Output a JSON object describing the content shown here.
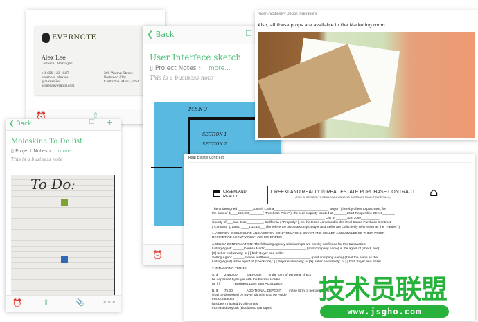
{
  "business_card": {
    "brand": "EVERNOTE",
    "name": "Alex Lee",
    "role": "General Manager",
    "contacts": [
      "+1 650 123 4567",
      "evernote_alexlee",
      "@alexavlee",
      "aclee@evernote.com"
    ],
    "address": [
      "305 Walnut Street",
      "Redwood City",
      "California 94063, USA"
    ]
  },
  "sketch_note": {
    "back": "Back",
    "title": "User Interface sketch",
    "notebook": "Project Notes",
    "more": "more...",
    "subtitle": "This is a business note",
    "sketch_labels": [
      "MENU",
      "SECTION 1",
      "SECTION 2"
    ]
  },
  "todo_note": {
    "back": "Back",
    "title": "Moleskine To Do list",
    "notebook": "Project Notes",
    "more": "more...",
    "subtitle": "This is a business note",
    "heading": "To Do:"
  },
  "paper_note": {
    "breadcrumb": "Paper › Stationery Design Inspirations",
    "caption": "Also, all these props are available in the Marketing room."
  },
  "contract": {
    "window_title": "Real Estate Contract",
    "logo": "CREEKLAND REALTY",
    "heading": "CREEKLAND REALTY ®    REAL ESTATE PURCHASE CONTRACT",
    "subheading": "(THIS IS INTENDED TO BE A LEGALLY BINDING CONTRACT. READ IT CAREFULLY.)",
    "lines": [
      "The undersigned ________Joseph Catina_____________________________(\"Buyer\" ) hereby offers to purchase, for",
      "the sum of $____450,000_______(      \"Purchase Price\"   ), the real property located at _______2654 Pepperdine Street_______",
      "_____________________________________________________________ City of ______San Jose__________",
      "County of ___San Jose_________, California (       \"Property\"  ), on the terms contained in this Real Estate Purchase Contract",
      "(\"Contract\"  ), dated ____4.12.13___ (for reference purposes only). Buyer and Seller are collectively referred to as the      \"Parties\" ).",
      "1.  AGENCY DISCLOSURE AND AGENCY CONFIRMATION:            BUYER AND SELLER ACKNOWLEDGE THEIR PRIOR",
      "     RECEIPT OF AGENCY DISCLOSURE FORMS.",
      "     AGENCY CONFIRMATION:     The following agency relationships are hereby confirmed for this transaction:",
      "     Listing Agent: ______Kerissa Martin______________________ (print company name) is the agent of (check one):",
      "     [X] Seller exclusively; or   [ ] both Buyer and Seller",
      "     Selling Agent: ______Steven Matthews______________________ (print company name) (if not the same as the",
      "     Listing Agent) is the agent of (check one):   [ ] Buyer exclusively; or  [X] Seller exclusively; or  [ ] both Buyer and Seller",
      "2. FINANCING TERMS:",
      "     A.  $ ___2,480.00_____     DEPOSIT___ in the form of personal check",
      "                                 be deposited by Buyer with the Escrow Holder",
      "                                 (or [ ]_______) Business Days after Acceptance",
      "     B.  $ ___75.00_______     ADDITIONAL DEPOSIT ___ in the form of personal check",
      "                                 shall be deposited by Buyer with the Escrow Holder",
      "                                 this Contract or  [ ]",
      "                                 has been initialed by all Parties",
      "                                 Increased Deposit (Liquidated Damages)"
    ]
  },
  "watermark": {
    "text": "技术员联盟",
    "url": "www.jsgho.com"
  },
  "colors": {
    "accent": "#4fbf7a",
    "sketch_bg": "#59b9e0",
    "watermark": "#27b23c"
  }
}
